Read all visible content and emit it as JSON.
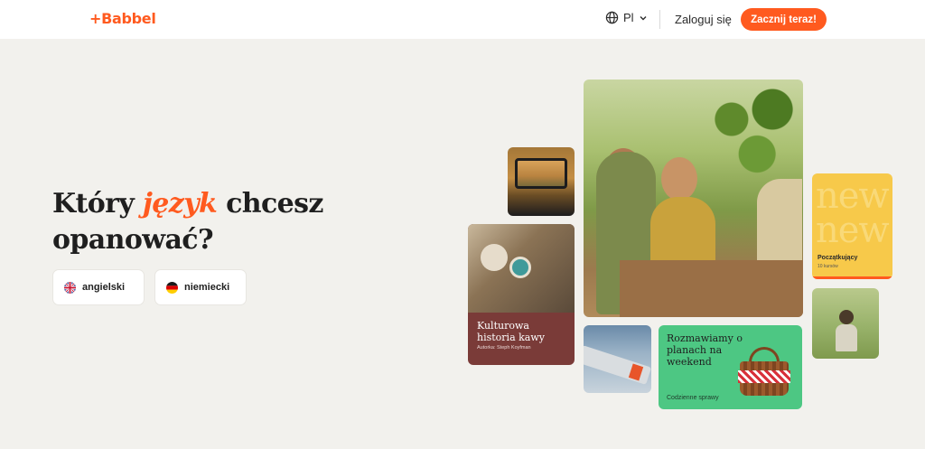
{
  "header": {
    "logo": "+Babbel",
    "language": "Pl",
    "login": "Zaloguj się",
    "cta": "Zacznij teraz!"
  },
  "hero": {
    "title_before": "Który ",
    "title_accent": "język",
    "title_after": " chcesz opanować?",
    "languages": [
      {
        "label": "angielski",
        "flag": "uk-flag"
      },
      {
        "label": "niemiecki",
        "flag": "germany-flag"
      }
    ]
  },
  "cards": {
    "coffee": {
      "title": "Kulturowa historia kawy",
      "author": "Autorka: Steph Koyfman"
    },
    "level": {
      "bg_word": "new",
      "level": "Początkujący",
      "count": "10 kursów"
    },
    "picnic": {
      "title": "Rozmawiamy o planach na weekend",
      "category": "Codzienne sprawy"
    }
  },
  "colors": {
    "accent": "#ff5a1f",
    "coffee_card": "#7a3b38",
    "picnic_card": "#4dc783",
    "level_card": "#f7c94a"
  }
}
